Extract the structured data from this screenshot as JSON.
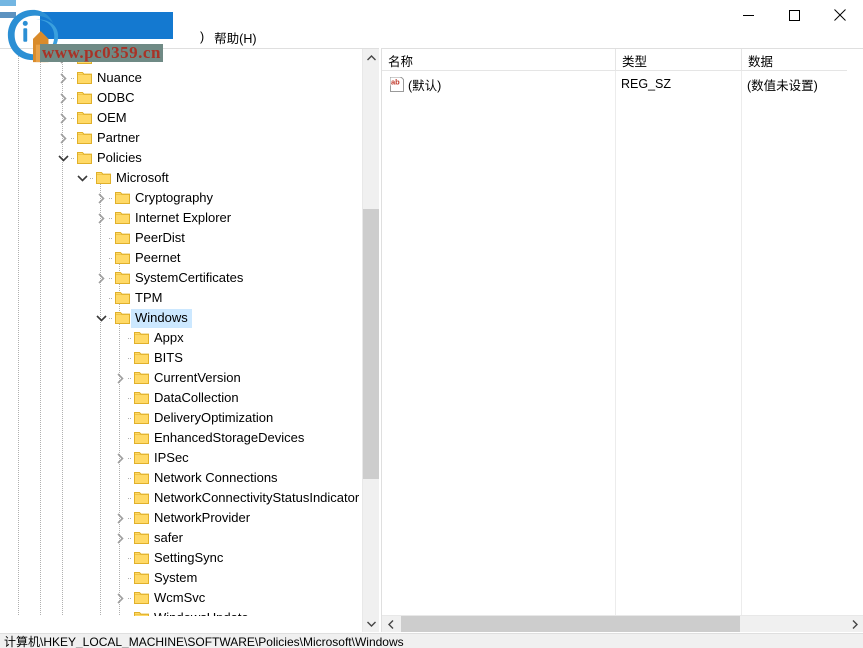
{
  "window": {
    "minimize_label": "─",
    "maximize_label": "□",
    "close_label": "✕"
  },
  "menubar": {
    "paren": ")",
    "items": [
      {
        "label": "帮助(H)"
      }
    ]
  },
  "tree": {
    "nodes": [
      {
        "label": "Nanimic",
        "depth": 1,
        "twisty": "collapsed",
        "selected": false
      },
      {
        "label": "Nuance",
        "depth": 1,
        "twisty": "collapsed",
        "selected": false
      },
      {
        "label": "ODBC",
        "depth": 1,
        "twisty": "collapsed",
        "selected": false
      },
      {
        "label": "OEM",
        "depth": 1,
        "twisty": "collapsed",
        "selected": false
      },
      {
        "label": "Partner",
        "depth": 1,
        "twisty": "collapsed",
        "selected": false
      },
      {
        "label": "Policies",
        "depth": 1,
        "twisty": "expanded",
        "selected": false
      },
      {
        "label": "Microsoft",
        "depth": 2,
        "twisty": "expanded",
        "selected": false
      },
      {
        "label": "Cryptography",
        "depth": 3,
        "twisty": "collapsed",
        "selected": false
      },
      {
        "label": "Internet Explorer",
        "depth": 3,
        "twisty": "collapsed",
        "selected": false
      },
      {
        "label": "PeerDist",
        "depth": 3,
        "twisty": "none",
        "selected": false
      },
      {
        "label": "Peernet",
        "depth": 3,
        "twisty": "none",
        "selected": false
      },
      {
        "label": "SystemCertificates",
        "depth": 3,
        "twisty": "collapsed",
        "selected": false
      },
      {
        "label": "TPM",
        "depth": 3,
        "twisty": "none",
        "selected": false
      },
      {
        "label": "Windows",
        "depth": 3,
        "twisty": "expanded",
        "selected": true
      },
      {
        "label": "Appx",
        "depth": 4,
        "twisty": "none",
        "selected": false
      },
      {
        "label": "BITS",
        "depth": 4,
        "twisty": "none",
        "selected": false
      },
      {
        "label": "CurrentVersion",
        "depth": 4,
        "twisty": "collapsed",
        "selected": false
      },
      {
        "label": "DataCollection",
        "depth": 4,
        "twisty": "none",
        "selected": false
      },
      {
        "label": "DeliveryOptimization",
        "depth": 4,
        "twisty": "none",
        "selected": false
      },
      {
        "label": "EnhancedStorageDevices",
        "depth": 4,
        "twisty": "none",
        "selected": false
      },
      {
        "label": "IPSec",
        "depth": 4,
        "twisty": "collapsed",
        "selected": false
      },
      {
        "label": "Network Connections",
        "depth": 4,
        "twisty": "none",
        "selected": false
      },
      {
        "label": "NetworkConnectivityStatusIndicator",
        "depth": 4,
        "twisty": "none",
        "selected": false
      },
      {
        "label": "NetworkProvider",
        "depth": 4,
        "twisty": "collapsed",
        "selected": false
      },
      {
        "label": "safer",
        "depth": 4,
        "twisty": "collapsed",
        "selected": false
      },
      {
        "label": "SettingSync",
        "depth": 4,
        "twisty": "none",
        "selected": false
      },
      {
        "label": "System",
        "depth": 4,
        "twisty": "none",
        "selected": false
      },
      {
        "label": "WcmSvc",
        "depth": 4,
        "twisty": "collapsed",
        "selected": false
      },
      {
        "label": "WindowsUpdate",
        "depth": 4,
        "twisty": "none",
        "selected": false
      }
    ]
  },
  "list": {
    "columns": [
      {
        "label": "名称"
      },
      {
        "label": "类型"
      },
      {
        "label": "数据"
      }
    ],
    "rows": [
      {
        "icon": "string-value-icon",
        "name": "(默认)",
        "type": "REG_SZ",
        "data": "(数值未设置)"
      }
    ]
  },
  "statusbar": {
    "path": "计算机\\HKEY_LOCAL_MACHINE\\SOFTWARE\\Policies\\Microsoft\\Windows"
  },
  "watermark": {
    "site": "www.pc0359.cn"
  },
  "scrollbars": {
    "tree_up": "⌃",
    "tree_down": "⌄",
    "list_left": "‹",
    "list_right": "›"
  },
  "colors": {
    "selection": "#cce8ff",
    "folder": "#ffd966",
    "folder_border": "#e0b02a",
    "scroll_thumb": "#cdcdcd",
    "watermark_blue": "#1479d0",
    "watermark_red": "#a83226"
  }
}
